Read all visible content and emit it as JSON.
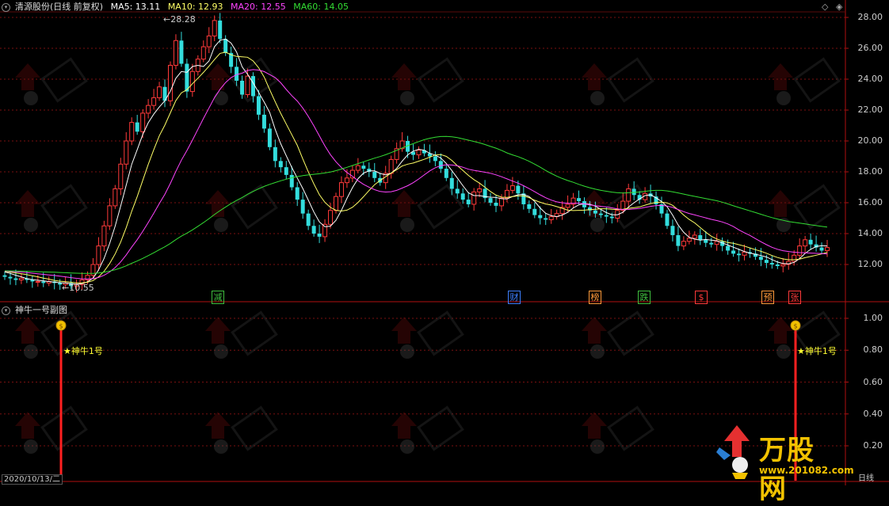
{
  "header": {
    "title": "清源股份(日线 前复权)",
    "ma5": "MA5: 13.11",
    "ma10": "MA10: 12.93",
    "ma20": "MA20: 12.55",
    "ma60": "MA60: 14.05"
  },
  "price_axis": [
    "28.00",
    "26.00",
    "24.00",
    "22.00",
    "20.00",
    "18.00",
    "16.00",
    "14.00",
    "12.00"
  ],
  "sub_axis": [
    "1.00",
    "0.80",
    "0.60",
    "0.40",
    "0.20"
  ],
  "annotations": {
    "high": "28.28",
    "low": "10.55"
  },
  "events": [
    {
      "label": "减",
      "color": "#3fbf3f"
    },
    {
      "label": "财",
      "color": "#3d7fff"
    },
    {
      "label": "榜",
      "color": "#ff9a3a"
    },
    {
      "label": "跌",
      "color": "#3fbf3f"
    },
    {
      "label": "$",
      "color": "#ff3a3a"
    },
    {
      "label": "预",
      "color": "#ff9a3a"
    },
    {
      "label": "张",
      "color": "#ff3a3a"
    }
  ],
  "sub_panel": {
    "title": "神牛一号副图",
    "signal_label_1": "★神牛1号",
    "signal_label_2": "★神牛1号"
  },
  "footer": {
    "date": "2020/10/13/二",
    "period": "日线"
  },
  "watermark": {
    "brand": "万股网",
    "url": "www.201082.com"
  },
  "colors": {
    "ma5": "#ffffff",
    "ma10": "#ffff66",
    "ma20": "#ff44ff",
    "ma60": "#33dd33",
    "up": "#ff3a3a",
    "down": "#33dddd"
  },
  "chart_data": {
    "type": "candlestick",
    "title": "清源股份(日线 前复权)",
    "ylim": [
      10.5,
      29
    ],
    "y_ticks": [
      12,
      14,
      16,
      18,
      20,
      22,
      24,
      26,
      28
    ],
    "high": 28.28,
    "low": 10.55,
    "series": [
      {
        "name": "MA5",
        "last": 13.11
      },
      {
        "name": "MA10",
        "last": 12.93
      },
      {
        "name": "MA20",
        "last": 12.55
      },
      {
        "name": "MA60",
        "last": 14.05
      }
    ],
    "close": [
      11.2,
      11.1,
      11.0,
      11.1,
      11.0,
      10.9,
      10.9,
      10.8,
      10.9,
      10.8,
      10.7,
      10.8,
      10.6,
      10.7,
      11.0,
      11.3,
      12.0,
      13.2,
      14.5,
      15.8,
      16.9,
      18.5,
      20.0,
      21.2,
      20.6,
      21.8,
      22.3,
      22.8,
      23.5,
      22.6,
      24.9,
      26.5,
      25.0,
      23.2,
      24.5,
      25.3,
      26.1,
      26.8,
      27.8,
      26.6,
      25.7,
      24.8,
      23.9,
      23.0,
      24.2,
      22.9,
      21.7,
      20.8,
      19.6,
      18.7,
      18.3,
      17.8,
      17.0,
      16.2,
      15.3,
      14.5,
      14.0,
      13.8,
      14.6,
      15.5,
      16.4,
      17.3,
      17.6,
      18.1,
      18.4,
      18.2,
      18.0,
      17.6,
      17.3,
      17.9,
      18.8,
      19.5,
      20.0,
      19.3,
      19.1,
      19.4,
      19.2,
      19.0,
      18.7,
      18.2,
      17.6,
      16.9,
      16.6,
      16.2,
      15.9,
      16.7,
      16.9,
      16.3,
      16.0,
      15.8,
      16.3,
      16.8,
      17.1,
      16.6,
      15.9,
      15.6,
      15.2,
      15.0,
      14.9,
      15.1,
      15.3,
      15.7,
      15.9,
      16.3,
      16.1,
      15.7,
      15.5,
      15.3,
      15.2,
      15.1,
      15.0,
      15.5,
      16.1,
      16.9,
      16.5,
      16.2,
      16.6,
      16.4,
      15.9,
      15.3,
      14.5,
      13.9,
      13.2,
      13.5,
      13.7,
      13.9,
      13.6,
      13.4,
      13.3,
      13.5,
      13.2,
      12.9,
      12.7,
      12.6,
      12.8,
      12.7,
      12.5,
      12.3,
      12.1,
      12.0,
      11.9,
      12.0,
      12.2,
      12.6,
      13.2,
      13.6,
      13.3,
      13.1,
      12.9,
      13.1
    ]
  }
}
